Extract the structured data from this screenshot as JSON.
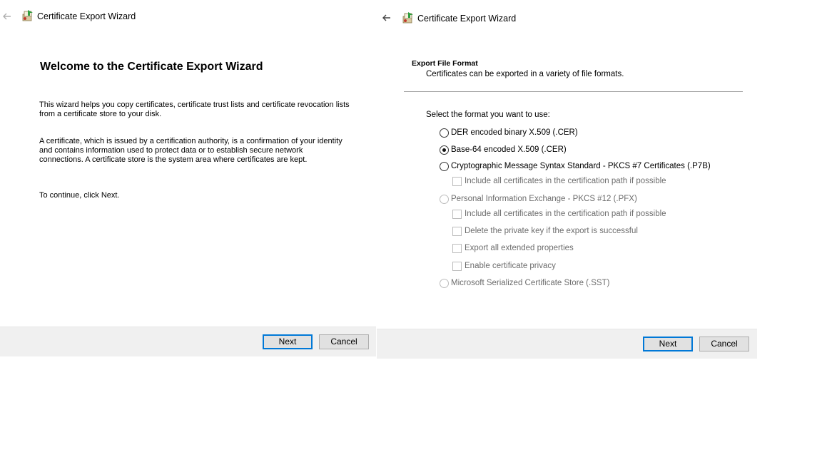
{
  "left": {
    "title": "Certificate Export Wizard",
    "heading": "Welcome to the Certificate Export Wizard",
    "paragraph1": "This wizard helps you copy certificates, certificate trust lists and certificate revocation lists from a certificate store to your disk.",
    "paragraph2": "A certificate, which is issued by a certification authority, is a confirmation of your identity and contains information used to protect data or to establish secure network connections. A certificate store is the system area where certificates are kept.",
    "paragraph3": "To continue, click Next.",
    "next_label": "Next",
    "cancel_label": "Cancel"
  },
  "right": {
    "title": "Certificate Export Wizard",
    "section_title": "Export File Format",
    "section_subtitle": "Certificates can be exported in a variety of file formats.",
    "prompt": "Select the format you want to use:",
    "options": [
      {
        "label": "DER encoded binary X.509 (.CER)",
        "type": "radio",
        "checked": false,
        "enabled": true
      },
      {
        "label": "Base-64 encoded X.509 (.CER)",
        "type": "radio",
        "checked": true,
        "enabled": true
      },
      {
        "label": "Cryptographic Message Syntax Standard - PKCS #7 Certificates (.P7B)",
        "type": "radio",
        "checked": false,
        "enabled": true
      },
      {
        "label": "Include all certificates in the certification path if possible",
        "type": "checkbox",
        "checked": false,
        "enabled": false
      },
      {
        "label": "Personal Information Exchange - PKCS #12 (.PFX)",
        "type": "radio",
        "checked": false,
        "enabled": false
      },
      {
        "label": "Include all certificates in the certification path if possible",
        "type": "checkbox",
        "checked": false,
        "enabled": false
      },
      {
        "label": "Delete the private key if the export is successful",
        "type": "checkbox",
        "checked": false,
        "enabled": false
      },
      {
        "label": "Export all extended properties",
        "type": "checkbox",
        "checked": false,
        "enabled": false
      },
      {
        "label": "Enable certificate privacy",
        "type": "checkbox",
        "checked": false,
        "enabled": false
      },
      {
        "label": "Microsoft Serialized Certificate Store (.SST)",
        "type": "radio",
        "checked": false,
        "enabled": false
      }
    ],
    "next_label": "Next",
    "cancel_label": "Cancel"
  },
  "colors": {
    "accent": "#0078d7",
    "footer_bg": "#f0f0f0",
    "button_bg": "#e1e1e1",
    "disabled_text": "#6d6d6d"
  },
  "icons": {
    "back": "back-arrow-icon",
    "app": "certificate-wizard-icon"
  }
}
